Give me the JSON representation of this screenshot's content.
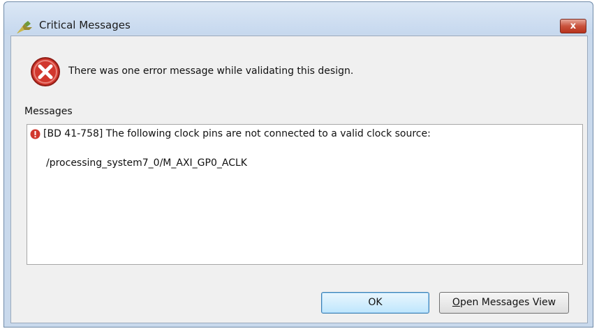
{
  "window": {
    "title": "Critical Messages",
    "close_label": "x"
  },
  "dialog": {
    "main_message": "There was one error message while validating this design.",
    "messages_label": "Messages",
    "message": {
      "line1": "[BD 41-758] The following clock pins are not connected to a valid clock source:",
      "line2": "/processing_system7_0/M_AXI_GP0_ACLK"
    }
  },
  "buttons": {
    "ok_label": "OK",
    "open_view_mnemonic": "O",
    "open_view_rest": "pen Messages View"
  },
  "icons": {
    "app": "vivado-logo-icon",
    "error": "error-icon",
    "message_error": "error-small-icon"
  },
  "colors": {
    "title_bar": "#c6d8ee",
    "close_button": "#c9523c",
    "error_red": "#d1372d"
  }
}
